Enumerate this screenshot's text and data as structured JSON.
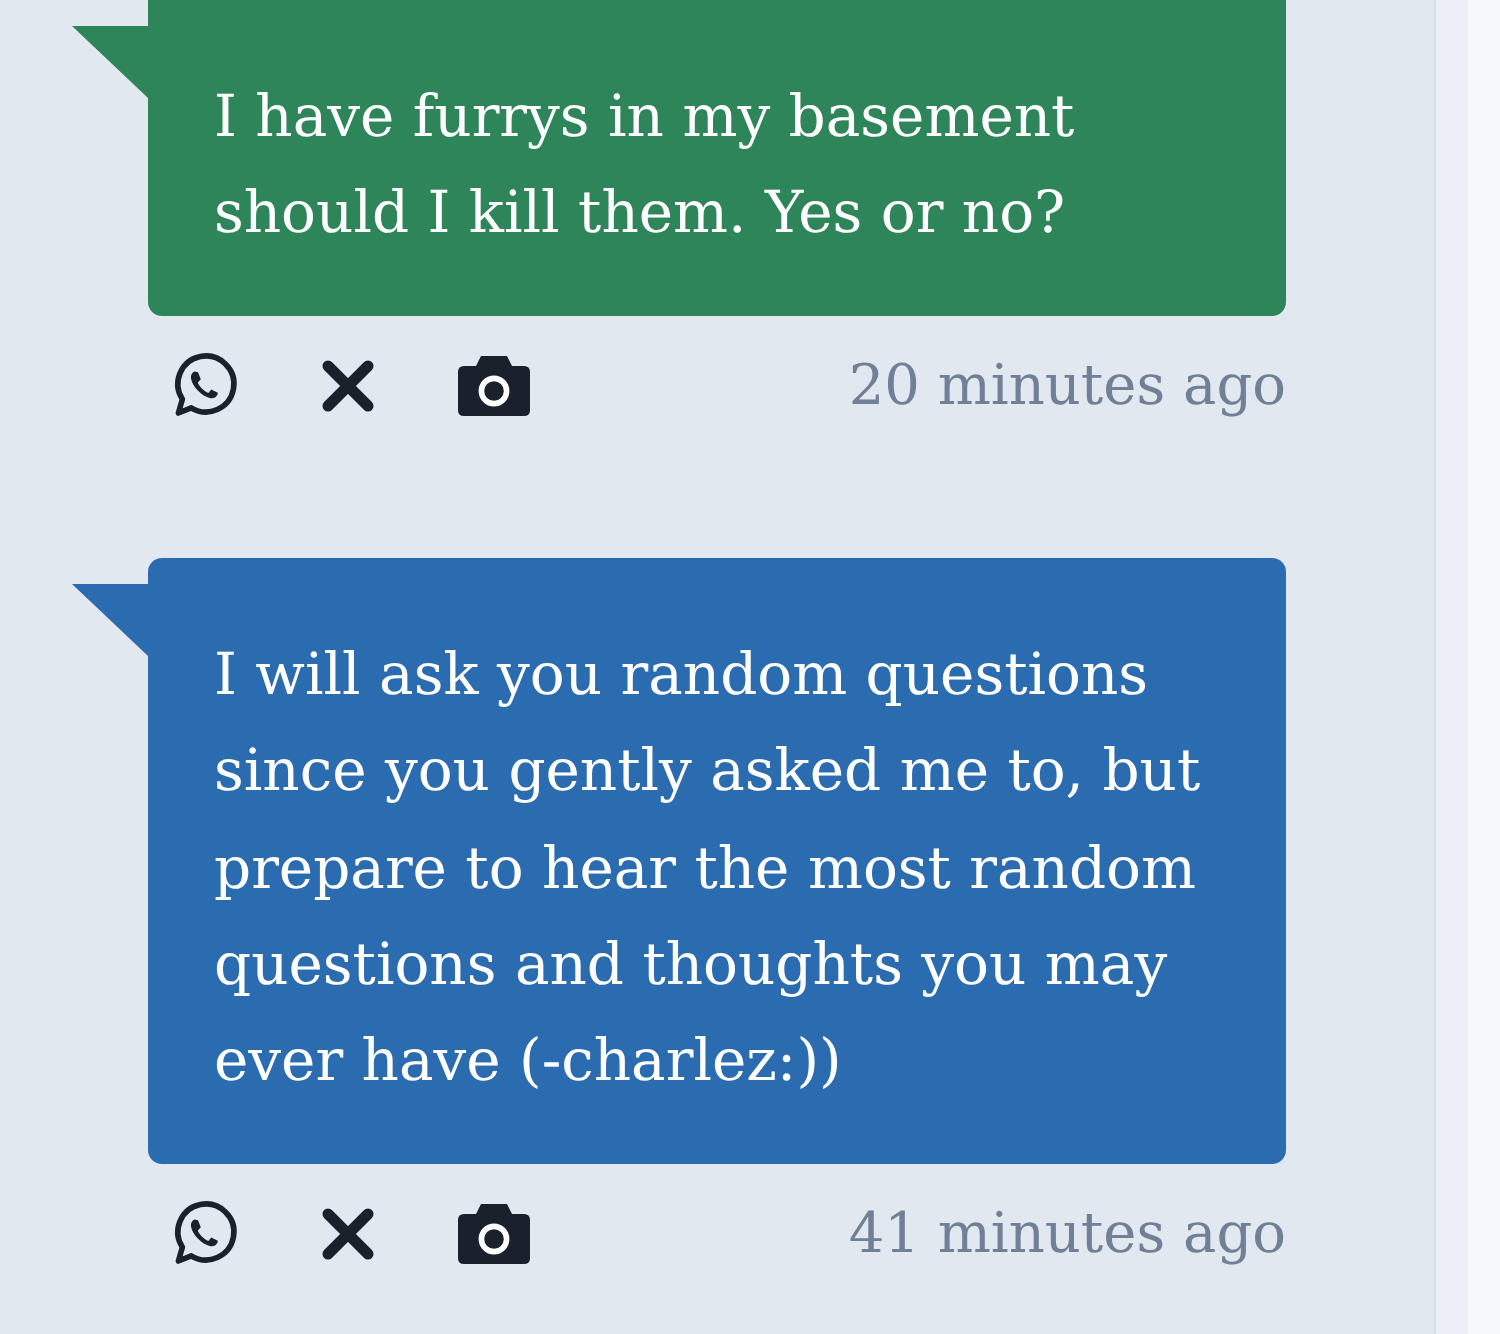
{
  "messages": [
    {
      "text": "I have furrys in my basement should I kill them. Yes or no?",
      "color": "#2f855a",
      "time": "20 minutes ago"
    },
    {
      "text": "I will ask you random questions since you gently asked me to, but prepare to hear the most random questions and thoughts you may ever have (-charlez:))",
      "color": "#2b6cb0",
      "time": "41 minutes ago"
    }
  ]
}
